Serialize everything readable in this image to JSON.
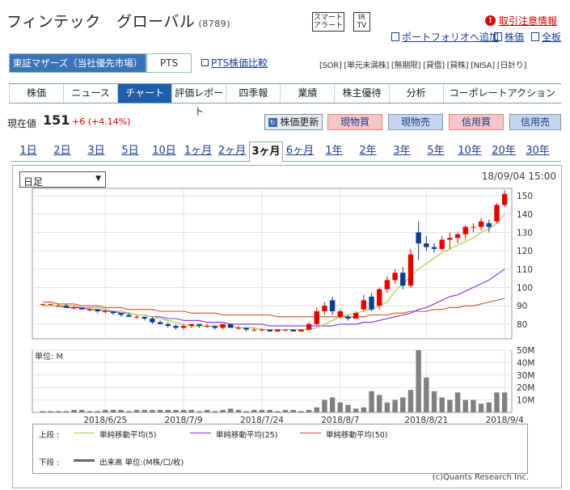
{
  "header": {
    "company": "フィンテック　グローバル",
    "code": "(8789)",
    "smart_alert": "スマートアラート",
    "ir_tv": "IR TV",
    "notice": "取引注意情報",
    "portfolio": "ポートフォリオへ追加",
    "kabuka": "株価",
    "zenban": "全板"
  },
  "market": {
    "active": "東証マザーズ（当社優先市場）",
    "pts": "PTS",
    "pts_compare": "PTS株価比較",
    "tags": "[SOR] [単元未満株] [無期限] [貸借] [貸株] [NISA] [日計り]"
  },
  "nav_tabs": [
    "株価",
    "ニュース",
    "チャート",
    "評価レポート",
    "四季報",
    "業績",
    "株主優待",
    "分析",
    "コーポレートアクション"
  ],
  "price": {
    "label": "現在値",
    "value": "151",
    "change": "+6 (+4.14%)",
    "refresh": "株価更新",
    "buy": "現物買",
    "sell": "現物売",
    "margin_buy": "信用買",
    "margin_sell": "信用売"
  },
  "periods": [
    "1日",
    "2日",
    "3日",
    "5日",
    "10日",
    "1ヶ月",
    "2ヶ月",
    "3ヶ月",
    "6ヶ月",
    "1年",
    "2年",
    "3年",
    "5年",
    "10年",
    "20年",
    "30年"
  ],
  "chart": {
    "period_select": "日足",
    "datetime": "18/09/04 15:00",
    "volume_unit": "単位: M",
    "copyright": "(c)Quants Research Inc.",
    "legend": {
      "upper_label": "上段 :",
      "ma5": "単純移動平均(5)",
      "ma25": "単純移動平均(25)",
      "ma50": "単純移動平均(50)",
      "lower_label": "下段 :",
      "volume": "出来高 単位:(M株/口/枚)"
    },
    "colors": {
      "up": "#e60000",
      "down": "#0a3d8f",
      "ma5": "#9acd32",
      "ma25": "#8a2be2",
      "ma50": "#d2501e",
      "volume": "#808080"
    }
  },
  "chart_data": {
    "type": "candlestick",
    "price_ylim": [
      72,
      154
    ],
    "price_ticks": [
      80,
      90,
      100,
      110,
      120,
      130,
      140,
      150
    ],
    "volume_ylim": [
      0,
      50
    ],
    "volume_ticks": [
      "10M",
      "20M",
      "30M",
      "40M",
      "50M"
    ],
    "volume_tick_values": [
      10,
      20,
      30,
      40,
      50
    ],
    "x_tick_labels": [
      "2018/6/25",
      "2018/7/9",
      "2018/7/24",
      "2018/8/7",
      "2018/8/21",
      "2018/9/4"
    ],
    "x_tick_index": [
      8,
      18,
      28,
      38,
      49,
      59
    ],
    "ohlc": [
      [
        91,
        91,
        90,
        91
      ],
      [
        91,
        91,
        90,
        91
      ],
      [
        90,
        91,
        90,
        90
      ],
      [
        90,
        91,
        89,
        89
      ],
      [
        89,
        90,
        88,
        89
      ],
      [
        89,
        89,
        88,
        88
      ],
      [
        88,
        89,
        87,
        88
      ],
      [
        88,
        88,
        86,
        87
      ],
      [
        87,
        88,
        86,
        87
      ],
      [
        87,
        87,
        85,
        86
      ],
      [
        86,
        86,
        84,
        85
      ],
      [
        85,
        86,
        84,
        84
      ],
      [
        84,
        85,
        83,
        84
      ],
      [
        84,
        84,
        82,
        83
      ],
      [
        83,
        84,
        80,
        81
      ],
      [
        81,
        82,
        80,
        80
      ],
      [
        80,
        81,
        78,
        79
      ],
      [
        79,
        80,
        77,
        78
      ],
      [
        78,
        80,
        77,
        79
      ],
      [
        79,
        80,
        78,
        80
      ],
      [
        80,
        80,
        78,
        79
      ],
      [
        79,
        80,
        78,
        79
      ],
      [
        79,
        79,
        77,
        78
      ],
      [
        78,
        80,
        77,
        80
      ],
      [
        80,
        80,
        78,
        78
      ],
      [
        78,
        79,
        77,
        78
      ],
      [
        78,
        78,
        76,
        77
      ],
      [
        77,
        78,
        76,
        77
      ],
      [
        77,
        78,
        76,
        77
      ],
      [
        77,
        77,
        76,
        76
      ],
      [
        76,
        77,
        76,
        77
      ],
      [
        77,
        77,
        76,
        77
      ],
      [
        77,
        77,
        76,
        76
      ],
      [
        76,
        77,
        76,
        77
      ],
      [
        77,
        81,
        77,
        80
      ],
      [
        80,
        89,
        79,
        87
      ],
      [
        87,
        92,
        85,
        90
      ],
      [
        93,
        95,
        85,
        87
      ],
      [
        84,
        88,
        83,
        87
      ],
      [
        84,
        85,
        82,
        83
      ],
      [
        83,
        87,
        83,
        86
      ],
      [
        88,
        96,
        87,
        93
      ],
      [
        95,
        97,
        87,
        88
      ],
      [
        90,
        100,
        88,
        99
      ],
      [
        99,
        106,
        97,
        104
      ],
      [
        104,
        110,
        102,
        108
      ],
      [
        108,
        111,
        99,
        101
      ],
      [
        101,
        121,
        100,
        118
      ],
      [
        130,
        136,
        115,
        124
      ],
      [
        124,
        128,
        120,
        122
      ],
      [
        122,
        124,
        119,
        121
      ],
      [
        121,
        128,
        120,
        126
      ],
      [
        126,
        130,
        121,
        127
      ],
      [
        127,
        130,
        124,
        129
      ],
      [
        129,
        134,
        126,
        133
      ],
      [
        133,
        135,
        130,
        133
      ],
      [
        133,
        138,
        131,
        136
      ],
      [
        135,
        137,
        130,
        133
      ],
      [
        136,
        146,
        135,
        145
      ],
      [
        145,
        153,
        144,
        151
      ]
    ],
    "ma5": [
      90,
      90,
      90,
      90,
      90,
      89,
      89,
      89,
      88,
      87,
      87,
      86,
      85,
      85,
      84,
      83,
      82,
      81,
      80,
      79,
      79,
      79,
      79,
      79,
      79,
      78,
      78,
      78,
      77,
      77,
      77,
      77,
      77,
      77,
      77,
      78,
      80,
      82,
      84,
      85,
      86,
      87,
      88,
      90,
      92,
      98,
      102,
      106,
      110,
      113,
      116,
      119,
      121,
      123,
      125,
      127,
      130,
      132,
      135,
      140
    ],
    "ma25": [
      90,
      90,
      90,
      89,
      89,
      89,
      88,
      88,
      87,
      87,
      86,
      86,
      85,
      85,
      84,
      84,
      83,
      83,
      82,
      82,
      82,
      81,
      81,
      81,
      80,
      80,
      80,
      80,
      80,
      79,
      79,
      79,
      79,
      79,
      79,
      79,
      79,
      79,
      80,
      80,
      80,
      81,
      81,
      82,
      83,
      84,
      85,
      86,
      88,
      89,
      91,
      93,
      95,
      96,
      98,
      100,
      102,
      104,
      107,
      110
    ],
    "ma50": [
      92,
      92,
      91,
      91,
      91,
      90,
      90,
      90,
      89,
      89,
      89,
      88,
      88,
      88,
      88,
      87,
      87,
      87,
      87,
      86,
      86,
      86,
      86,
      85,
      85,
      85,
      85,
      85,
      85,
      85,
      84,
      84,
      84,
      84,
      84,
      84,
      84,
      84,
      84,
      84,
      84,
      84,
      85,
      85,
      85,
      86,
      86,
      87,
      87,
      87,
      88,
      88,
      89,
      89,
      90,
      90,
      91,
      92,
      93,
      94
    ],
    "volume": [
      1,
      1,
      1,
      1,
      2,
      2,
      1,
      1,
      2,
      2,
      2,
      1,
      2,
      2,
      2,
      2,
      2,
      2,
      2,
      2,
      1,
      2,
      1,
      2,
      3,
      2,
      1,
      2,
      2,
      2,
      1,
      2,
      2,
      1,
      2,
      4,
      10,
      12,
      8,
      6,
      3,
      4,
      17,
      14,
      8,
      10,
      12,
      18,
      50,
      28,
      17,
      12,
      10,
      16,
      10,
      10,
      7,
      8,
      16,
      16
    ]
  }
}
